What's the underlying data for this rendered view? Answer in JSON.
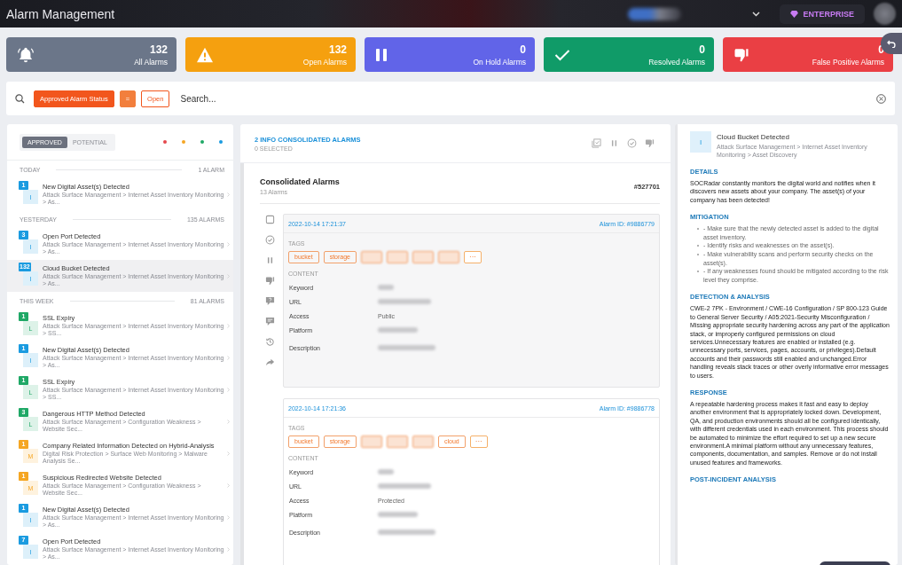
{
  "header": {
    "title": "Alarm Management",
    "plan": "ENTERPRISE"
  },
  "stats": [
    {
      "kind": "bell",
      "count": "132",
      "label": "All Alarms",
      "color": "#6b7689"
    },
    {
      "kind": "warning",
      "count": "132",
      "label": "Open Alarms",
      "color": "#f5a00f"
    },
    {
      "kind": "pause",
      "count": "0",
      "label": "On Hold Alarms",
      "color": "#6164e8"
    },
    {
      "kind": "check",
      "count": "0",
      "label": "Resolved Alarms",
      "color": "#109b68"
    },
    {
      "kind": "thumbs-down",
      "count": "0",
      "label": "False Positive Alarms",
      "color": "#ea3f44"
    }
  ],
  "search": {
    "chips": [
      {
        "kind": "filled",
        "label": "Approved Alarm Status"
      },
      {
        "kind": "operator",
        "label": "="
      },
      {
        "kind": "outlined",
        "label": "Open"
      }
    ],
    "placeholder": "Search..."
  },
  "alarm_list": {
    "tabs": [
      {
        "label": "APPROVED",
        "selected": true
      },
      {
        "label": "POTENTIAL",
        "selected": false
      }
    ],
    "severity_dots": [
      {
        "color": "#e5484d"
      },
      {
        "color": "#f5a623"
      },
      {
        "color": "#1fa866"
      },
      {
        "color": "#1a9be0"
      }
    ],
    "groups": [
      {
        "title": "TODAY",
        "count": "1 ALARM",
        "items": [
          {
            "count": "1",
            "letter": "I",
            "color": "#1a9be0",
            "title": "New Digital Asset(s) Detected",
            "path": "Attack Surface Management > Internet Asset Inventory Monitoring > As...",
            "selected": false
          }
        ]
      },
      {
        "title": "YESTERDAY",
        "count": "135 ALARMS",
        "items": [
          {
            "count": "3",
            "letter": "I",
            "color": "#1a9be0",
            "title": "Open Port Detected",
            "path": "Attack Surface Management > Internet Asset Inventory Monitoring > As...",
            "selected": false
          },
          {
            "count": "132",
            "letter": "I",
            "color": "#1a9be0",
            "title": "Cloud Bucket Detected",
            "path": "Attack Surface Management > Internet Asset Inventory Monitoring > As...",
            "selected": true
          }
        ]
      },
      {
        "title": "THIS WEEK",
        "count": "81 ALARMS",
        "items": [
          {
            "count": "1",
            "letter": "L",
            "color": "#1fa866",
            "title": "SSL Expiry",
            "path": "Attack Surface Management > Internet Asset Inventory Monitoring > SS...",
            "selected": false
          },
          {
            "count": "1",
            "letter": "I",
            "color": "#1a9be0",
            "title": "New Digital Asset(s) Detected",
            "path": "Attack Surface Management > Internet Asset Inventory Monitoring > As...",
            "selected": false
          },
          {
            "count": "1",
            "letter": "L",
            "color": "#1fa866",
            "title": "SSL Expiry",
            "path": "Attack Surface Management > Internet Asset Inventory Monitoring > SS...",
            "selected": false
          },
          {
            "count": "3",
            "letter": "L",
            "color": "#1fa866",
            "title": "Dangerous HTTP Method Detected",
            "path": "Attack Surface Management > Configuration Weakness > Website Sec...",
            "selected": false
          },
          {
            "count": "1",
            "letter": "M",
            "color": "#f5a623",
            "title": "Company Related Information Detected on Hybrid-Analysis",
            "path": "Digital Risk Protection > Surface Web Monitoring > Malware Analysis Se...",
            "selected": false
          },
          {
            "count": "1",
            "letter": "M",
            "color": "#f5a623",
            "title": "Suspicious Redirected Website Detected",
            "path": "Attack Surface Management > Configuration Weakness > Website Sec...",
            "selected": false
          },
          {
            "count": "1",
            "letter": "I",
            "color": "#1a9be0",
            "title": "New Digital Asset(s) Detected",
            "path": "Attack Surface Management > Internet Asset Inventory Monitoring > As...",
            "selected": false
          },
          {
            "count": "7",
            "letter": "I",
            "color": "#1a9be0",
            "title": "Open Port Detected",
            "path": "Attack Surface Management > Internet Asset Inventory Monitoring > As...",
            "selected": false
          }
        ]
      }
    ]
  },
  "consolidated": {
    "title": "2 INFO CONSOLIDATED ALARMS",
    "selected_count": "0 SELECTED",
    "card_title": "Consolidated Alarms",
    "card_subtitle": "13 Alarms",
    "reference": "#527701",
    "checked": false,
    "alarms": [
      {
        "date": "2022-10-14 17:21:37",
        "alarm_id": "Alarm ID: #9886779",
        "tags_label": "TAGS",
        "tags": [
          {
            "label": "bucket"
          },
          {
            "label": "storage"
          },
          {
            "blurred": true
          },
          {
            "blurred": true
          },
          {
            "blurred": true
          },
          {
            "blurred": true
          }
        ],
        "more": "···",
        "content_label": "CONTENT",
        "fields": [
          {
            "label": "Keyword",
            "blurred": true
          },
          {
            "label": "URL",
            "blurred": true
          },
          {
            "label": "Access",
            "value": "Public"
          },
          {
            "label": "Platform",
            "blurred": true
          },
          {
            "label": "Description",
            "blurred": true
          }
        ]
      },
      {
        "date": "2022-10-14 17:21:36",
        "alarm_id": "Alarm ID: #9886778",
        "tags_label": "TAGS",
        "tags": [
          {
            "label": "bucket"
          },
          {
            "label": "storage"
          },
          {
            "blurred": true
          },
          {
            "blurred": true
          },
          {
            "blurred": true
          },
          {
            "label": "cloud"
          }
        ],
        "more": "···",
        "content_label": "CONTENT",
        "fields": [
          {
            "label": "Keyword",
            "blurred": true
          },
          {
            "label": "URL",
            "blurred": true
          },
          {
            "label": "Access",
            "value": "Protected"
          },
          {
            "label": "Platform",
            "blurred": true
          },
          {
            "label": "Description",
            "blurred": true
          }
        ]
      }
    ]
  },
  "detail": {
    "letter": "I",
    "title": "Cloud Bucket Detected",
    "path": "Attack Surface Management > Internet Asset Inventory Monitoring > Asset Discovery",
    "sections": [
      {
        "kind": "paragraph",
        "heading": "DETAILS",
        "text": "SOCRadar constantly monitors the digital world and notifies when it discovers new assets about your company. The asset(s) of your company has been detected!"
      },
      {
        "kind": "list",
        "heading": "MITIGATION",
        "items": [
          "- Make sure that the newly detected asset is added to the digital asset inventory.",
          "- Identify risks and weaknesses on the asset(s).",
          "- Make vulnerability scans and perform security checks on the asset(s).",
          "- If any weaknesses found should be mitigated according to the risk level they comprise."
        ]
      },
      {
        "kind": "paragraph",
        "heading": "DETECTION & ANALYSIS",
        "text": "CWE-2 7PK - Environment / CWE-16 Configuration / SP 800-123 Guide to General Server Security / A05:2021-Security Misconfiguration / Missing appropriate security hardening across any part of the application stack, or improperly configured permissions on cloud services.Unnecessary features are enabled or installed (e.g. unnecessary ports, services, pages, accounts, or privileges).Default accounts and their passwords still enabled and unchanged.Error handling reveals stack traces or other overly informative error messages to users."
      },
      {
        "kind": "paragraph",
        "heading": "RESPONSE",
        "text": "A repeatable hardening process makes it fast and easy to deploy another environment that is appropriately locked down. Development, QA, and production environments should all be configured identically, with different credentials used in each environment. This process should be automated to minimize the effort required to set up a new secure environment.A minimal platform without any unnecessary features, components, documentation, and samples. Remove or do not install unused features and frameworks."
      },
      {
        "kind": "heading",
        "heading": "POST-INCIDENT ANALYSIS"
      }
    ]
  }
}
